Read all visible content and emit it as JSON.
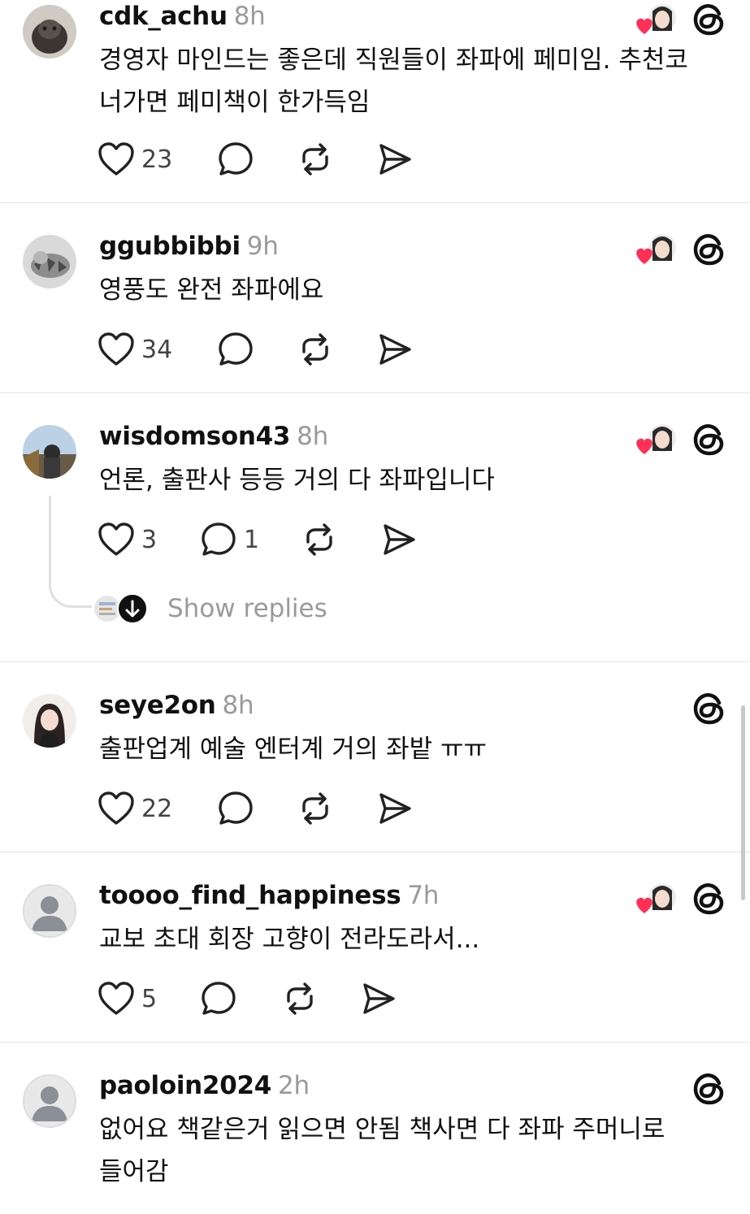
{
  "posts": [
    {
      "username": "cdk_achu",
      "time": "8h",
      "text": "경영자 마인드는 좋은데 직원들이 좌파에 페미임. 추천코\n너가면 페미책이 한가득임",
      "likes": "23",
      "replies": "",
      "author_liked": true
    },
    {
      "username": "ggubbibbi",
      "time": "9h",
      "text": "영풍도 완전 좌파에요",
      "likes": "34",
      "replies": "",
      "author_liked": true
    },
    {
      "username": "wisdomson43",
      "time": "8h",
      "text": "언론, 출판사 등등 거의 다 좌파입니다",
      "likes": "3",
      "replies": "1",
      "author_liked": true
    },
    {
      "username": "seye2on",
      "time": "8h",
      "text": "출판업계 예술 엔터계 거의 좌밭 ㅠㅠ",
      "likes": "22",
      "replies": "",
      "author_liked": false
    },
    {
      "username": "toooo_find_happiness",
      "time": "7h",
      "text": "교보 초대 회장 고향이 전라도라서...",
      "likes": "5",
      "replies": "",
      "author_liked": true
    },
    {
      "username": "paoloin2024",
      "time": "2h",
      "text": "없어요 책같은거 읽으면 안됨 책사면 다 좌파 주머니로\n들어감",
      "likes": "",
      "replies": "",
      "author_liked": false
    }
  ],
  "show_replies_label": "Show replies",
  "colors": {
    "heart": "#ff2f55",
    "muted": "#9a9a9a",
    "divider": "#e3e3e3"
  },
  "icons": [
    "heart-icon",
    "comment-icon",
    "repost-icon",
    "share-icon",
    "threads-icon",
    "chevron-down-icon"
  ]
}
